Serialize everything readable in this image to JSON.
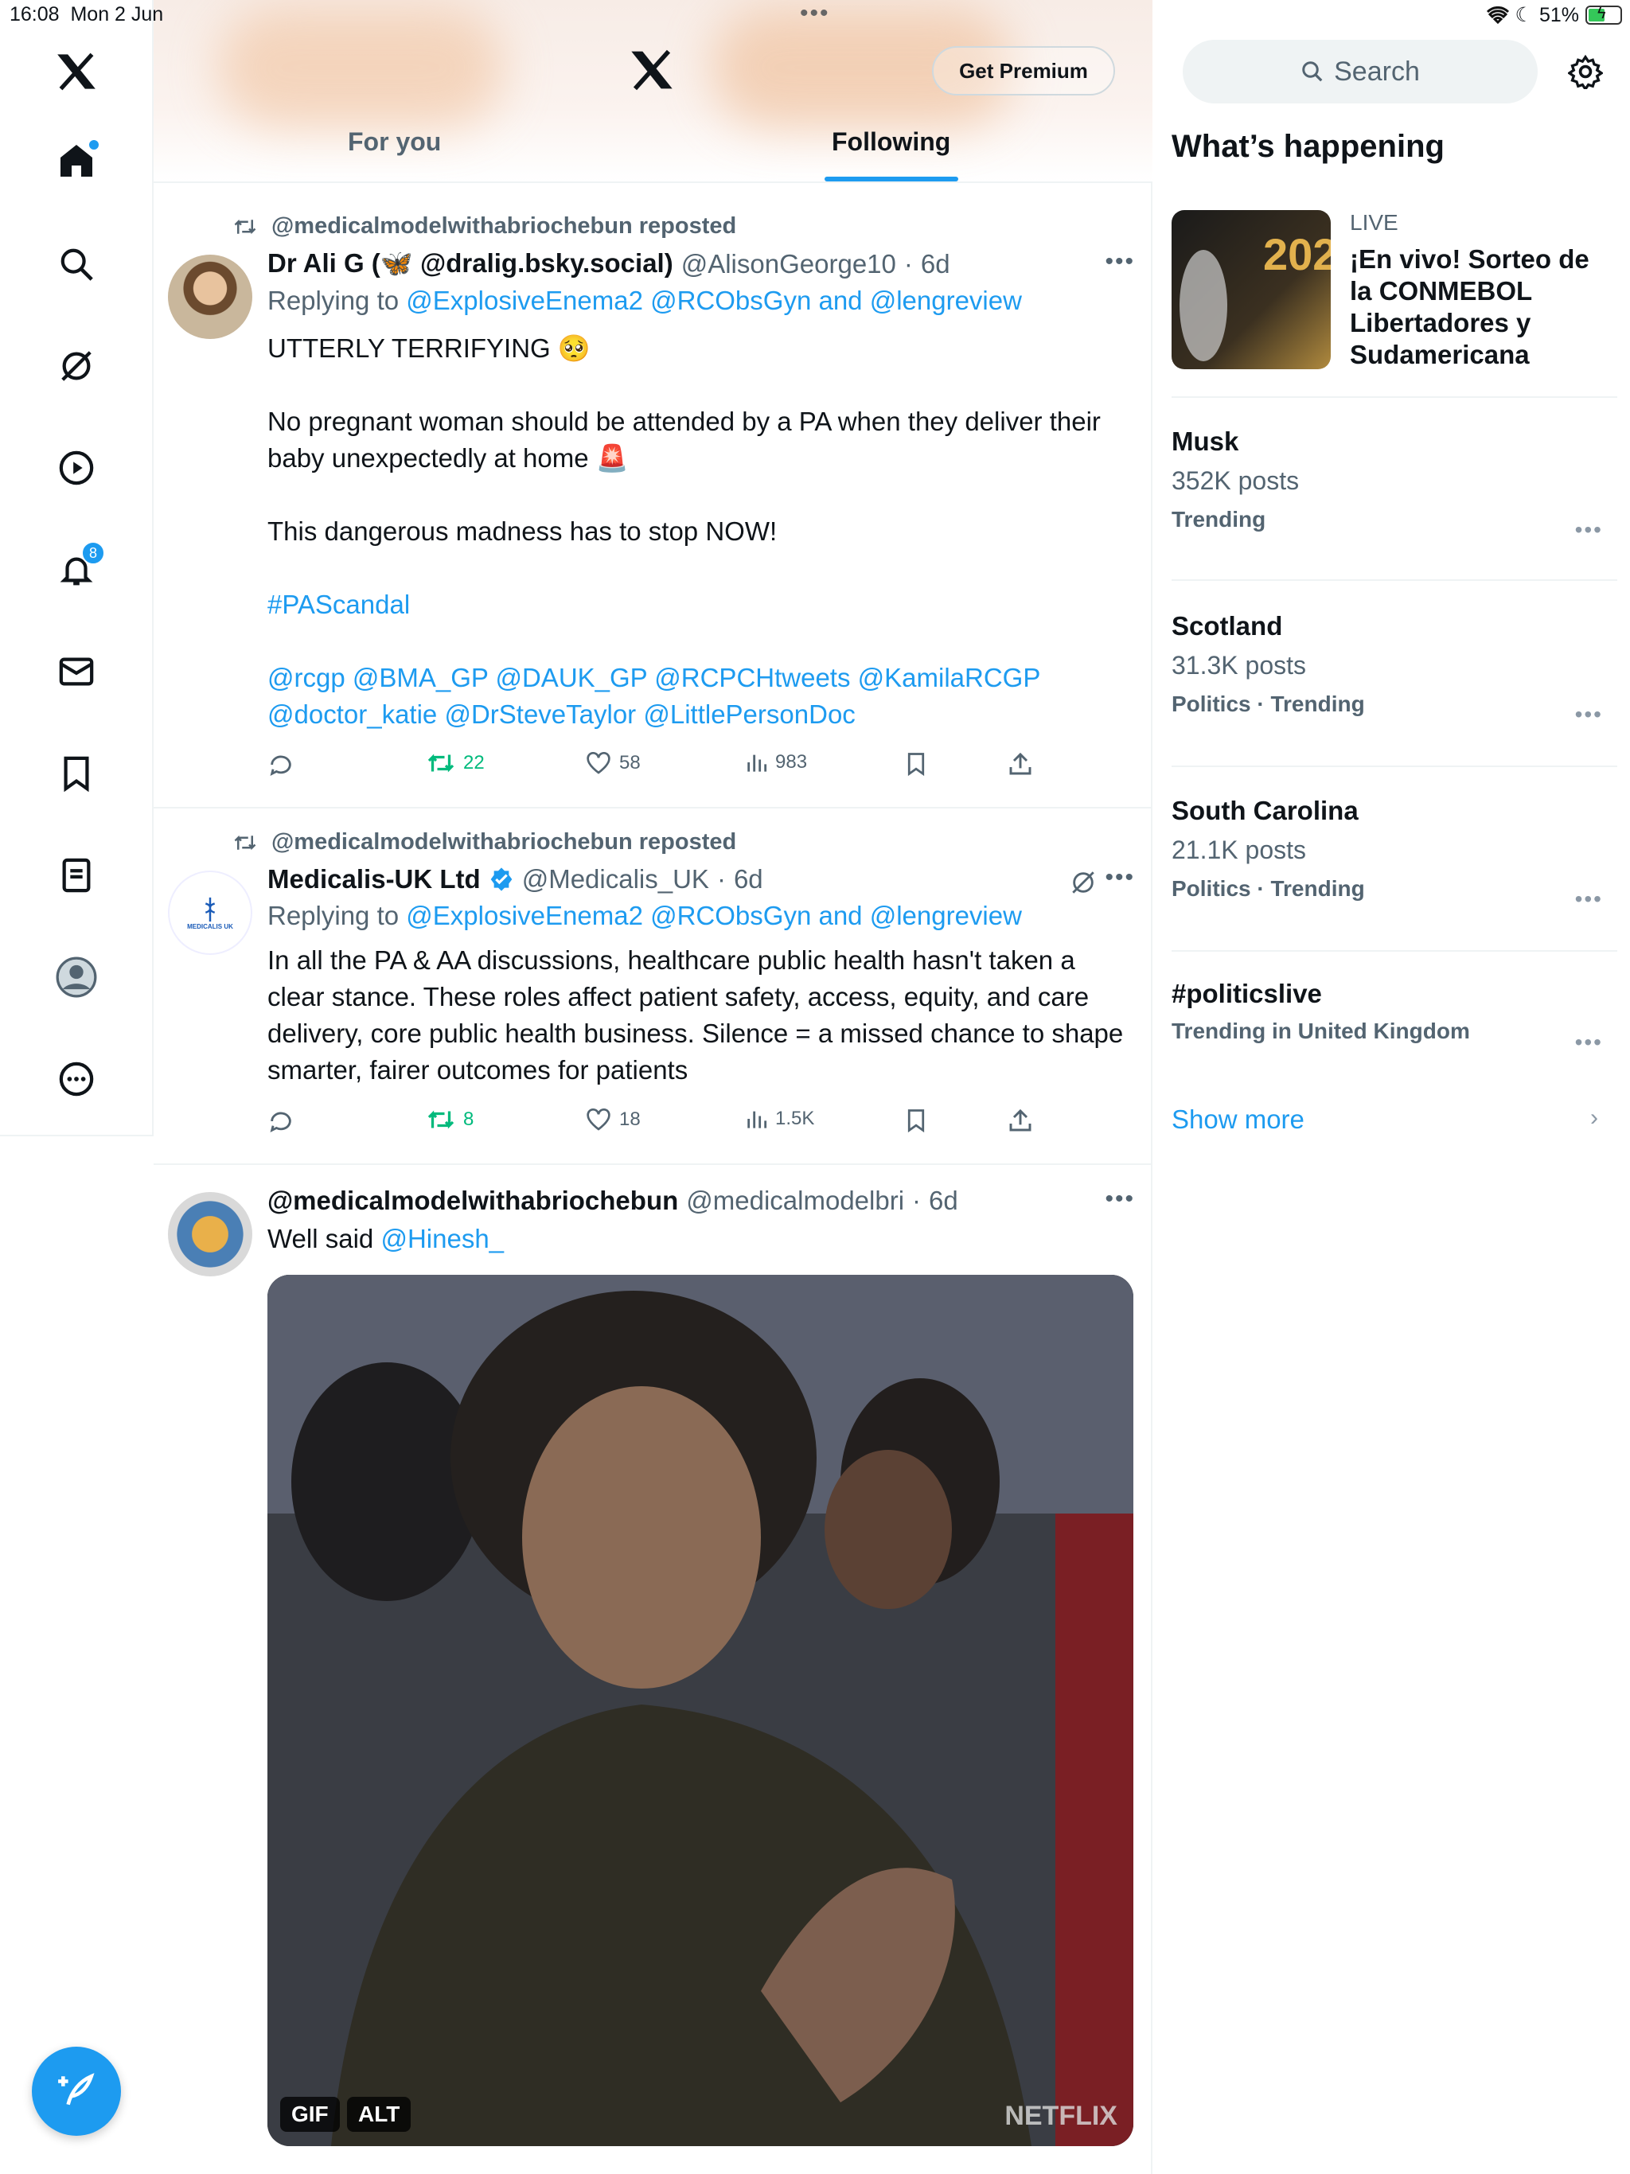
{
  "status": {
    "time": "16:08",
    "date": "Mon 2 Jun",
    "battery": "51%"
  },
  "rail": {
    "items": [
      "home",
      "explore",
      "grok",
      "video",
      "notifications",
      "messages",
      "bookmarks",
      "lists",
      "profile",
      "more"
    ],
    "notifications_badge": "8"
  },
  "header": {
    "premium_label": "Get Premium",
    "tabs": [
      "For you",
      "Following"
    ],
    "active_tab": "Following"
  },
  "tweets": [
    {
      "repost_label": "@medicalmodelwithabriochebun reposted",
      "name": "Dr Ali G (🦋 @dralig.bsky.social)",
      "handle": "@AlisonGeorge10",
      "time": "6d",
      "reply_prefix": "Replying to",
      "reply_to": "@ExplosiveEnema2 @RCObsGyn and @lengreview",
      "text_1": "UTTERLY TERRIFYING 🥺",
      "text_2": "No pregnant woman should be attended by a PA when they deliver their baby unexpectedly at home 🚨",
      "text_3": "This dangerous madness has to stop NOW!",
      "hashtag": "#PAScandal",
      "mentions": "@rcgp @BMA_GP @DAUK_GP @RCPCHtweets @KamilaRCGP @doctor_katie @DrSteveTaylor @LittlePersonDoc",
      "retweets": "22",
      "likes": "58",
      "views": "983"
    },
    {
      "repost_label": "@medicalmodelwithabriochebun reposted",
      "name": "Medicalis-UK Ltd",
      "handle": "@Medicalis_UK",
      "time": "6d",
      "reply_prefix": "Replying to",
      "reply_to": "@ExplosiveEnema2 @RCObsGyn and @lengreview",
      "text": "In all the PA & AA discussions, healthcare public health hasn't taken a clear stance. These roles affect patient safety, access, equity, and care delivery, core public health business. Silence = a missed chance to shape smarter, fairer outcomes for patients",
      "avatar_text": "MEDICALIS UK",
      "retweets": "8",
      "likes": "18",
      "views": "1.5K"
    },
    {
      "name": "@medicalmodelwithabriochebun",
      "handle": "@medicalmodelbri",
      "time": "6d",
      "text_prefix": "Well said",
      "mention": "@Hinesh_",
      "media_tags": [
        "GIF",
        "ALT"
      ],
      "watermark": "NETFLIX"
    }
  ],
  "sidebar": {
    "search_placeholder": "Search",
    "heading": "What’s happening",
    "live": {
      "label": "LIVE",
      "title": "¡En vivo! Sorteo de la CONMEBOL Libertadores y Sudamericana"
    },
    "trends": [
      {
        "name": "Musk",
        "posts": "352K posts",
        "category": "Trending"
      },
      {
        "name": "Scotland",
        "posts": "31.3K posts",
        "category": "Politics · Trending"
      },
      {
        "name": "South Carolina",
        "posts": "21.1K posts",
        "category": "Politics · Trending"
      },
      {
        "name": "#politicslive",
        "posts": "",
        "category": "Trending in United Kingdom"
      }
    ],
    "show_more": "Show more"
  },
  "colors": {
    "accent": "#1d9bf0",
    "repost_green": "#00ba7c",
    "muted": "#536471"
  }
}
